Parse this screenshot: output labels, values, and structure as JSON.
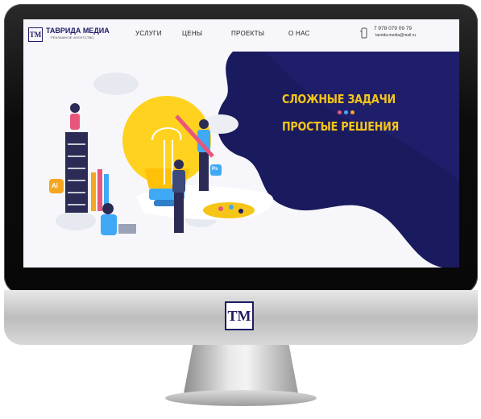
{
  "brand": {
    "logo_letters": "TM",
    "name": "ТАВРИДА МЕДИА",
    "tagline": "РЕКЛАМНОЕ АГЕНТСТВО"
  },
  "nav": {
    "items": [
      {
        "label": "УСЛУГИ"
      },
      {
        "label": "ЦЕНЫ"
      },
      {
        "label": "ПРОЕКТЫ"
      },
      {
        "label": "О НАС"
      }
    ]
  },
  "contacts": {
    "phone": "7 978 079 09 79",
    "email": "tavrida.media@mail.ru"
  },
  "hero": {
    "line1": "СЛОЖНЫЕ ЗАДАЧИ",
    "line2": "ПРОСТЫЕ РЕШЕНИЯ",
    "badge_ai": "Ai",
    "badge_ps": "Ps"
  },
  "colors": {
    "navy": "#1f1b66",
    "accent_yellow": "#f5c518",
    "dot_pink": "#e8567c",
    "dot_blue": "#4aa8e8",
    "dot_orange": "#f5a623"
  },
  "chin_logo": "TM"
}
